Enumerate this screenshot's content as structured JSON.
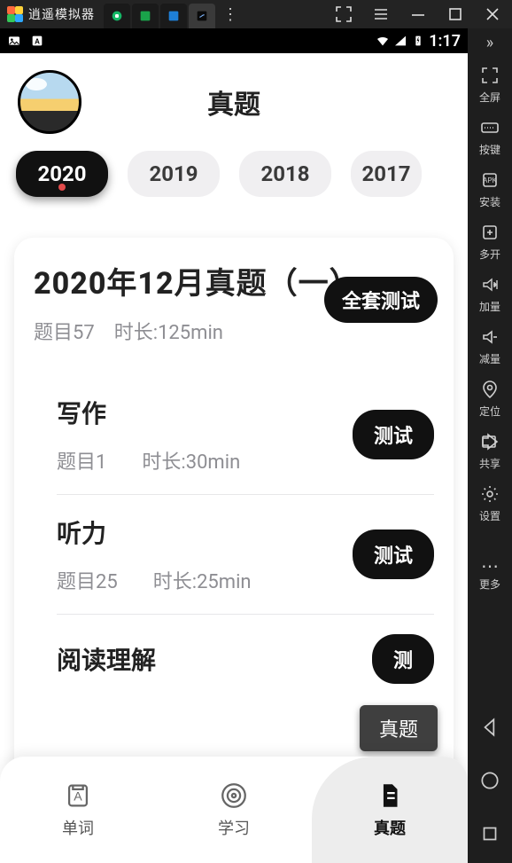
{
  "emulator": {
    "name": "逍遥模拟器",
    "window_controls": {
      "minimize": "—",
      "maximize": "☐",
      "close": "✕"
    }
  },
  "side_panel": {
    "items": [
      {
        "icon": "fullscreen-icon",
        "label": "全屏"
      },
      {
        "icon": "keyboard-icon",
        "label": "按键"
      },
      {
        "icon": "apk-icon",
        "label": "安装"
      },
      {
        "icon": "multi-icon",
        "label": "多开"
      },
      {
        "icon": "volup-icon",
        "label": "加量"
      },
      {
        "icon": "voldown-icon",
        "label": "减量"
      },
      {
        "icon": "location-icon",
        "label": "定位"
      },
      {
        "icon": "share-icon",
        "label": "共享"
      },
      {
        "icon": "settings-icon",
        "label": "设置"
      }
    ],
    "more_label": "更多"
  },
  "statusbar": {
    "time": "1:17"
  },
  "app": {
    "title": "真题",
    "years": [
      "2020",
      "2019",
      "2018",
      "2017"
    ],
    "active_year_index": 0,
    "paper": {
      "title": "2020年12月真题（一）",
      "q_count_label": "题目57",
      "duration_label": "时长:125min",
      "full_test_label": "全套测试",
      "sections": [
        {
          "name": "写作",
          "q": "题目1",
          "dur": "时长:30min",
          "btn": "测试"
        },
        {
          "name": "听力",
          "q": "题目25",
          "dur": "时长:25min",
          "btn": "测试"
        },
        {
          "name": "阅读理解",
          "q": "",
          "dur": "",
          "btn": "测"
        }
      ]
    },
    "bottom_nav": {
      "items": [
        {
          "label": "单词",
          "icon": "book-icon"
        },
        {
          "label": "学习",
          "icon": "target-icon"
        },
        {
          "label": "真题",
          "icon": "exam-icon"
        }
      ],
      "active_index": 2
    },
    "toast": "真题"
  }
}
